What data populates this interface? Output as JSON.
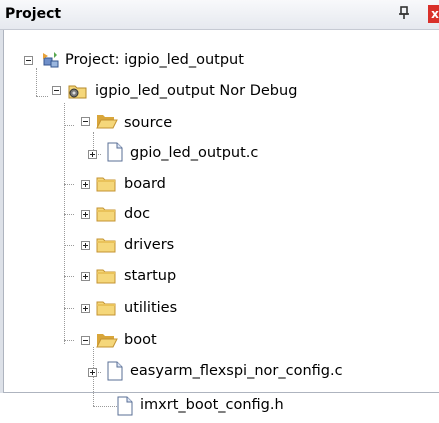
{
  "panel": {
    "title": "Project",
    "pin_glyph": "ꟷ",
    "close_glyph": "x"
  },
  "tree": {
    "project": {
      "label": "Project: igpio_led_output",
      "icon": "project-icon",
      "expanded": true
    },
    "target": {
      "label": "igpio_led_output Nor Debug",
      "icon": "target-icon",
      "expanded": true
    },
    "groups": [
      {
        "label": "source",
        "expanded": true,
        "icon": "folder-open-icon"
      },
      {
        "label": "board",
        "expanded": false,
        "icon": "folder-icon"
      },
      {
        "label": "doc",
        "expanded": false,
        "icon": "folder-icon"
      },
      {
        "label": "drivers",
        "expanded": false,
        "icon": "folder-icon"
      },
      {
        "label": "startup",
        "expanded": false,
        "icon": "folder-icon"
      },
      {
        "label": "utilities",
        "expanded": false,
        "icon": "folder-icon"
      },
      {
        "label": "boot",
        "expanded": true,
        "icon": "folder-open-icon"
      }
    ],
    "files": {
      "source": [
        {
          "label": "gpio_led_output.c",
          "expandable": true
        }
      ],
      "boot": [
        {
          "label": "easyarm_flexspi_nor_config.c",
          "expandable": true
        },
        {
          "label": "imxrt_boot_config.h",
          "expandable": false
        }
      ]
    }
  },
  "colors": {
    "folder": "#f5d77a",
    "folder_dark": "#d9a63a",
    "close": "#d9302a",
    "tree_line": "#9a9a9a"
  }
}
